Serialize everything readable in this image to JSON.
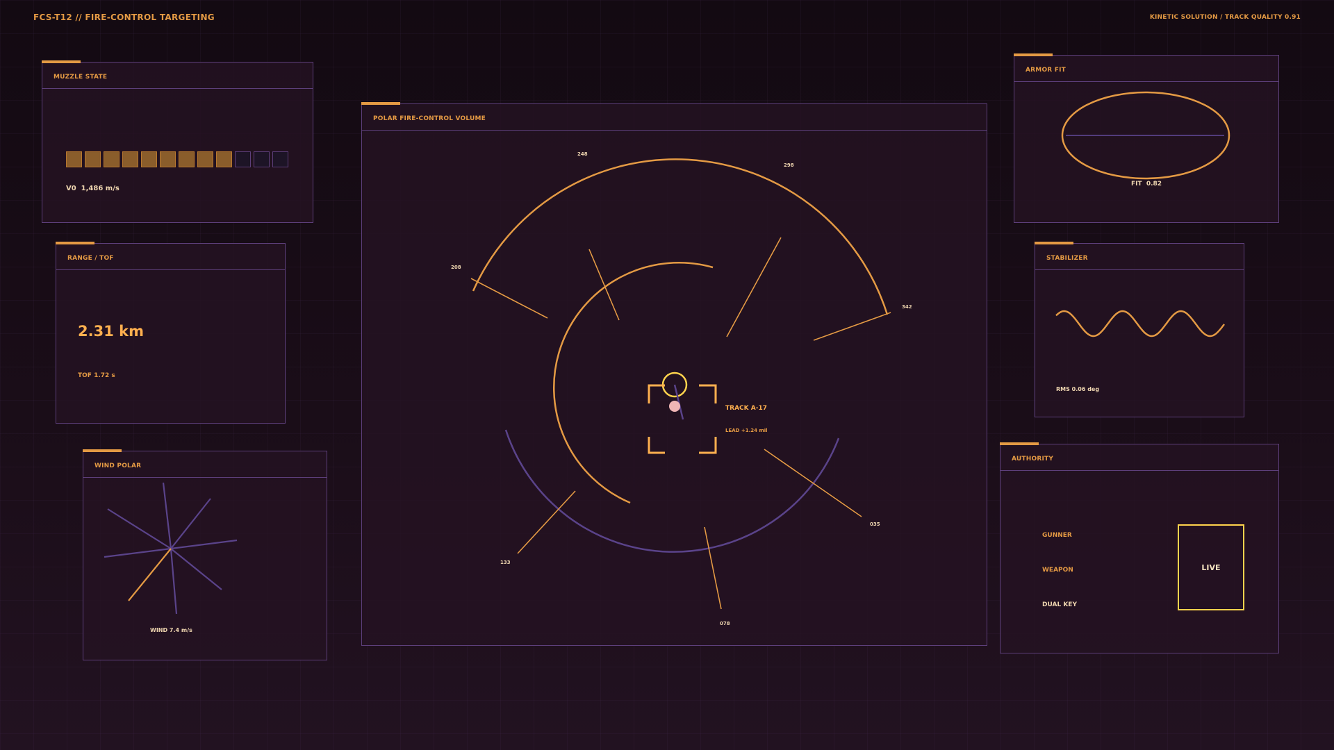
{
  "header": {
    "title_left": "FCS-T12  //  FIRE-CONTROL TARGETING",
    "title_right": "KINETIC SOLUTION / TRACK QUALITY 0.91"
  },
  "colors": {
    "accent": "#e49a44",
    "border": "#5d3f7b",
    "violet": "#5a438a",
    "live": "#ffd34d"
  },
  "muzzle_state": {
    "title": "MUZZLE STATE",
    "velocity_text": "V0  1,486 m/s",
    "cells_total": 12,
    "cells_filled": 9
  },
  "range_tof": {
    "title": "RANGE / TOF",
    "range_text": "2.31 km",
    "tof_text": "TOF 1.72 s"
  },
  "wind_polar": {
    "title": "WIND POLAR",
    "wind_text": "WIND 7.4 m/s"
  },
  "polar_volume": {
    "title": "POLAR FIRE-CONTROL VOLUME",
    "bearings": [
      "248",
      "298",
      "208",
      "342",
      "133",
      "035",
      "078"
    ],
    "track_label": "TRACK A-17",
    "lead_label": "LEAD +1.24 mil"
  },
  "armor_fit": {
    "title": "ARMOR FIT",
    "fit_text": "FIT  0.82"
  },
  "stabilizer": {
    "title": "STABILIZER",
    "rms_text": "RMS 0.06 deg"
  },
  "authority": {
    "title": "AUTHORITY",
    "items": [
      "GUNNER",
      "WEAPON",
      "DUAL KEY"
    ],
    "live_label": "LIVE"
  }
}
